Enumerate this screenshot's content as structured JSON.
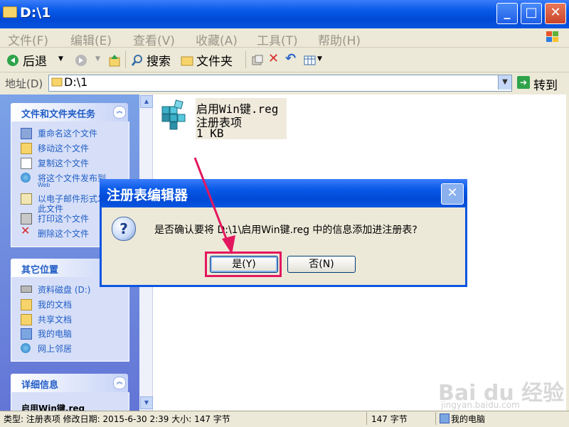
{
  "window": {
    "title": "D:\\1"
  },
  "menu": [
    "文件(F)",
    "编辑(E)",
    "查看(V)",
    "收藏(A)",
    "工具(T)",
    "帮助(H)"
  ],
  "toolbar": {
    "back": "后退",
    "search": "搜索",
    "folders": "文件夹"
  },
  "address": {
    "label": "地址(D)",
    "value": "D:\\1",
    "go": "转到"
  },
  "tasks_panel": {
    "title": "文件和文件夹任务",
    "items": [
      "重命名这个文件",
      "移动这个文件",
      "复制这个文件",
      "将这个文件发布到",
      "Web",
      "以电子邮件形式发",
      "此文件",
      "打印这个文件",
      "删除这个文件"
    ]
  },
  "places_panel": {
    "title": "其它位置",
    "items": [
      "资料磁盘 (D:)",
      "我的文档",
      "共享文档",
      "我的电脑",
      "网上邻居"
    ]
  },
  "details_panel": {
    "title": "详细信息",
    "item": "启用Win键.reg"
  },
  "file": {
    "name": "启用Win键.reg",
    "type": "注册表项",
    "size": "1 KB"
  },
  "dialog": {
    "title": "注册表编辑器",
    "message": "是否确认要将 D:\\1\\启用Win键.reg 中的信息添加进注册表?",
    "yes": "是(Y)",
    "no": "否(N)"
  },
  "status": {
    "info": "类型: 注册表项  修改日期: 2015-6-30 2:39 大小: 147 字节",
    "size": "147 字节",
    "location": "我的电脑"
  },
  "watermark": {
    "brand": "Bai du 经验",
    "url": "jingyan.baidu.com"
  },
  "colors": {
    "titlebar": "#0a5ae8",
    "highlight": "#e3175f",
    "task_link": "#215dc6"
  }
}
